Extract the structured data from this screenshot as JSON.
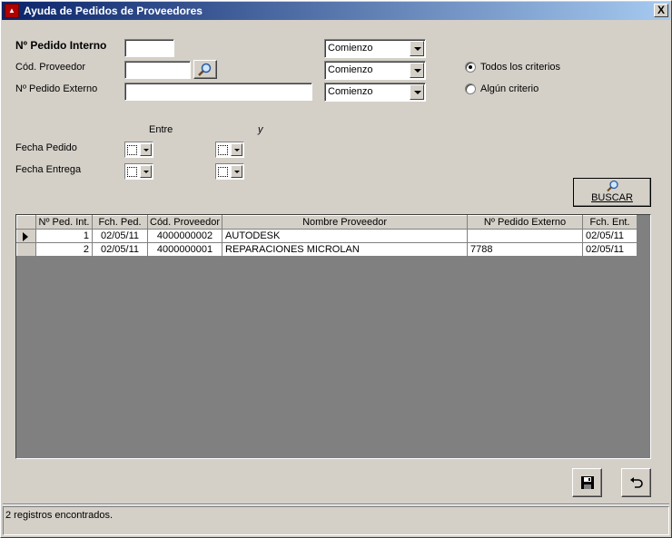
{
  "window": {
    "title": "Ayuda de Pedidos de Proveedores",
    "close_glyph": "X",
    "icon": "app-icon"
  },
  "form": {
    "pedido_interno_label": "Nº Pedido Interno",
    "pedido_interno_value": "",
    "cod_proveedor_label": "Cód. Proveedor",
    "cod_proveedor_value": "",
    "pedido_externo_label": "Nº Pedido Externo",
    "pedido_externo_value": "",
    "combo_interno": "Comienzo",
    "combo_proveedor": "Comienzo",
    "combo_externo": "Comienzo",
    "radio_todos": "Todos los criterios",
    "radio_algun": "Algún criterio",
    "radio_selected": "todos",
    "entre_label": "Entre",
    "y_label": "y",
    "fecha_pedido_label": "Fecha Pedido",
    "fecha_entrega_label": "Fecha Entrega",
    "buscar_label": "BUSCAR"
  },
  "grid": {
    "columns": [
      "Nº Ped. Int.",
      "Fch. Ped.",
      "Cód. Proveedor",
      "Nombre Proveedor",
      "Nº Pedido Externo",
      "Fch. Ent."
    ],
    "rows": [
      {
        "ped_int": "1",
        "fch_ped": "02/05/11",
        "cod_prov": "4000000002",
        "nombre": "AUTODESK",
        "ped_ext": "",
        "fch_ent": "02/05/11"
      },
      {
        "ped_int": "2",
        "fch_ped": "02/05/11",
        "cod_prov": "4000000001",
        "nombre": "REPARACIONES MICROLAN",
        "ped_ext": "7788",
        "fch_ent": "02/05/11"
      }
    ]
  },
  "toolbar": {
    "save_icon": "floppy-disk-icon",
    "undo_icon": "undo-icon"
  },
  "status": {
    "text": "2 registros encontrados."
  }
}
